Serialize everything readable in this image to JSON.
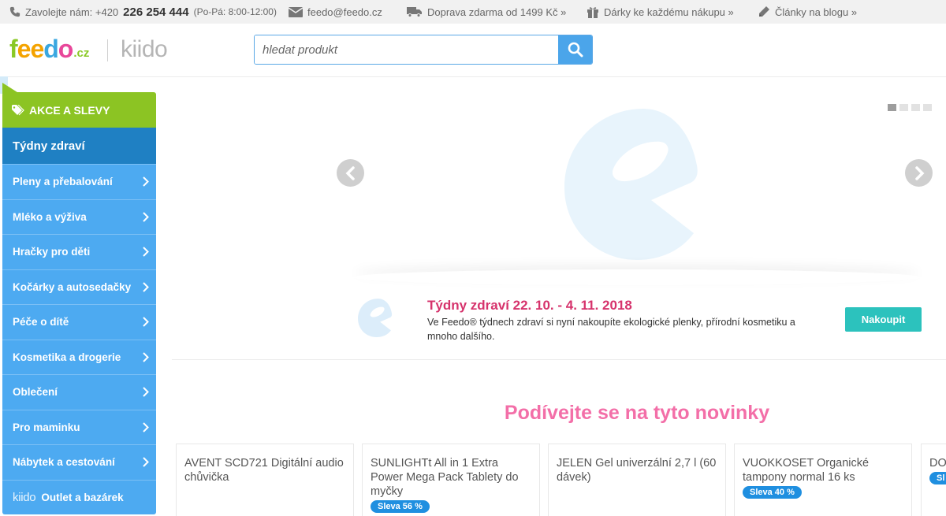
{
  "topbar": {
    "call_label": "Zavolejte nám: +420",
    "phone": "226 254 444",
    "hours": "(Po-Pá: 8:00-12:00)",
    "email": "feedo@feedo.cz",
    "shipping": "Doprava zdarma od 1499 Kč »",
    "gifts": "Dárky ke každému nákupu »",
    "blog": "Články na blogu »"
  },
  "header": {
    "logo": {
      "part1": "f",
      "part2": "ee",
      "part3": "d",
      "part4": "o",
      "suffix": ".cz"
    },
    "kiido": "kiido",
    "search_placeholder": "hledat produkt"
  },
  "sidebar": {
    "akce": "AKCE A SLEVY",
    "active": "Týdny zdraví",
    "items": [
      "Pleny a přebalování",
      "Mléko a výživa",
      "Hračky pro děti",
      "Kočárky a autosedačky",
      "Péče o dítě",
      "Kosmetika a drogerie",
      "Oblečení",
      "Pro maminku",
      "Nábytek a cestování"
    ],
    "outlet_brand": "kiido",
    "outlet": "Outlet a bazárek"
  },
  "banner": {
    "slides": 4,
    "active_slide": 1,
    "promo_title": "Týdny zdraví 22. 10. - 4. 11. 2018",
    "promo_text": "Ve Feedo® týdnech zdraví si nyní nakoupíte ekologické plenky, přírodní kosmetiku a mnoho dalšího.",
    "promo_button": "Nakoupit"
  },
  "news": {
    "title": "Podívejte se na tyto novinky",
    "products": [
      {
        "name": "AVENT SCD721 Digitální audio chůvička",
        "badge": ""
      },
      {
        "name": "SUNLIGHTt All in 1 Extra Power Mega Pack Tablety do myčky",
        "badge": "Sleva 56 %"
      },
      {
        "name": "JELEN Gel univerzální 2,7 l (60 dávek)",
        "badge": ""
      },
      {
        "name": "VUOKKOSET Organické tampony normal 16 ks",
        "badge": "Sleva 40 %"
      },
      {
        "name": "DO",
        "badge": "Sl"
      }
    ]
  },
  "colors": {
    "green": "#8cc423",
    "blue_dark": "#1f80c3",
    "blue": "#4daaf1",
    "pink": "#f36fa8",
    "teal": "#2cc2bd",
    "promo_pink": "#d6336c"
  }
}
